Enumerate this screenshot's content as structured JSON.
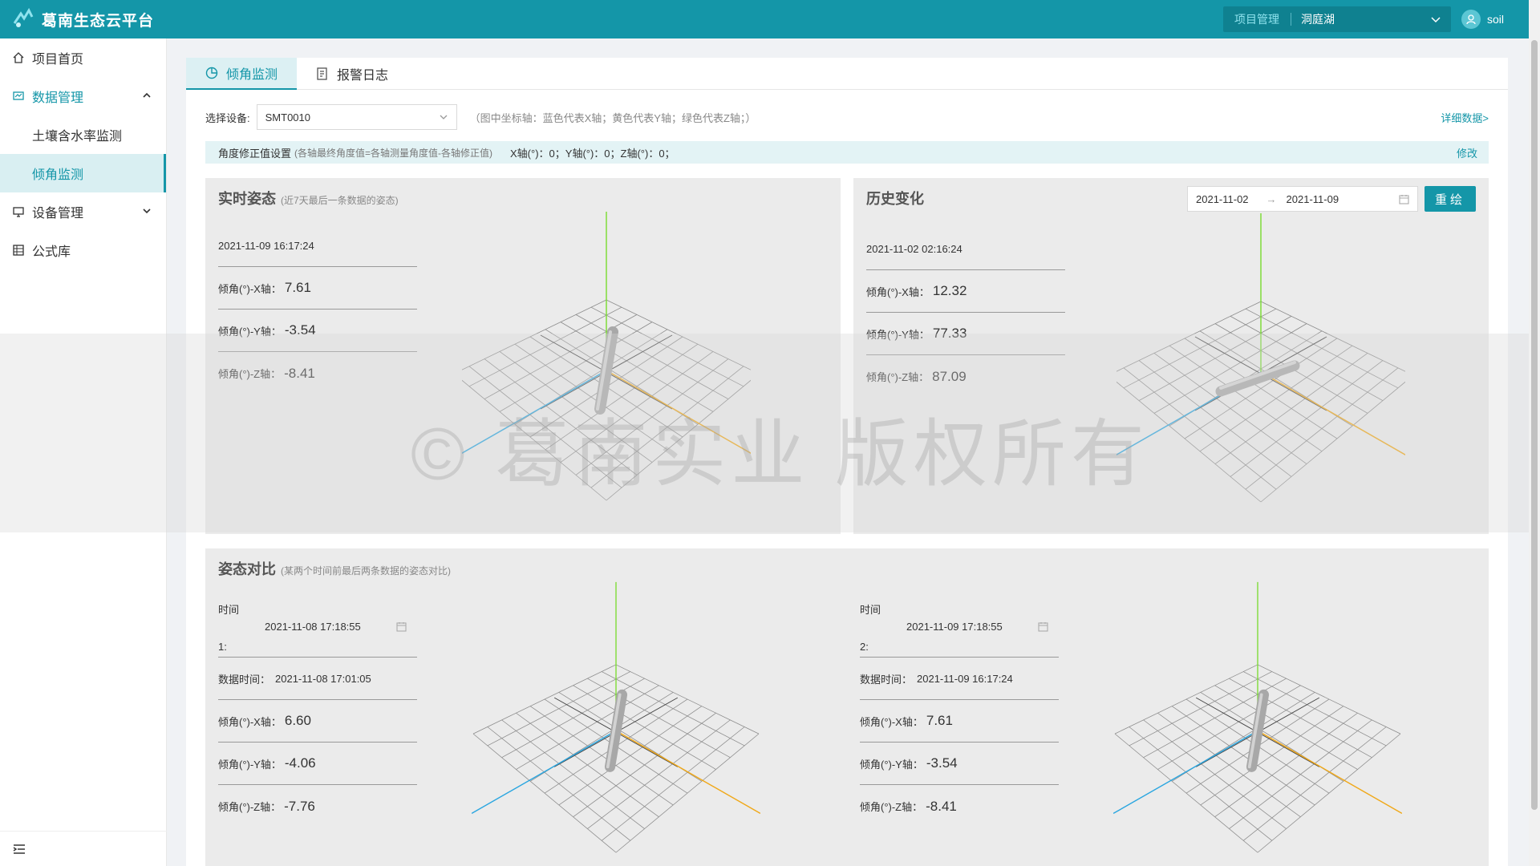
{
  "header": {
    "app_title": "葛南生态云平台",
    "project_label": "项目管理",
    "project_value": "洞庭湖",
    "user_name": "soil"
  },
  "sidebar": {
    "items": [
      {
        "label": "项目首页",
        "icon": "home-icon"
      },
      {
        "label": "数据管理",
        "icon": "chart-icon",
        "expanded": true
      },
      {
        "label": "土壤含水率监测",
        "sub": true
      },
      {
        "label": "倾角监测",
        "sub": true,
        "active": true
      },
      {
        "label": "设备管理",
        "icon": "monitor-icon"
      },
      {
        "label": "公式库",
        "icon": "table-icon"
      }
    ]
  },
  "tabs": [
    {
      "label": "倾角监测",
      "icon": "pie-icon",
      "active": true
    },
    {
      "label": "报警日志",
      "icon": "log-icon"
    }
  ],
  "device": {
    "label": "选择设备:",
    "value": "SMT0010",
    "hint": "（图中坐标轴：蓝色代表X轴；黄色代表Y轴；绿色代表Z轴；）",
    "detail_link": "详细数据>"
  },
  "correction": {
    "label": "角度修正值设置",
    "sub": "(各轴最终角度值=各轴测量角度值-各轴修正值)",
    "values": "X轴(°)：0；Y轴(°)：0；Z轴(°)：0；",
    "edit": "修改"
  },
  "realtime": {
    "title": "实时姿态",
    "subtitle": "(近7天最后一条数据的姿态)",
    "time": "2021-11-09 16:17:24",
    "x_label": "倾角(°)-X轴：",
    "x": "7.61",
    "y_label": "倾角(°)-Y轴：",
    "y": "-3.54",
    "z_label": "倾角(°)-Z轴：",
    "z": "-8.41"
  },
  "history": {
    "title": "历史变化",
    "start_date": "2021-11-02",
    "end_date": "2021-11-09",
    "redraw": "重绘",
    "time": "2021-11-02 02:16:24",
    "x_label": "倾角(°)-X轴：",
    "x": "12.32",
    "y_label": "倾角(°)-Y轴：",
    "y": "77.33",
    "z_label": "倾角(°)-Z轴：",
    "z": "87.09"
  },
  "compare": {
    "title": "姿态对比",
    "subtitle": "(某两个时间前最后两条数据的姿态对比)",
    "left": {
      "time_label": "时间",
      "index": "1:",
      "picker": "2021-11-08 17:18:55",
      "data_time_label": "数据时间：",
      "data_time": "2021-11-08 17:01:05",
      "x_label": "倾角(°)-X轴：",
      "x": "6.60",
      "y_label": "倾角(°)-Y轴：",
      "y": "-4.06",
      "z_label": "倾角(°)-Z轴：",
      "z": "-7.76"
    },
    "right": {
      "time_label": "时间",
      "index": "2:",
      "picker": "2021-11-09 17:18:55",
      "data_time_label": "数据时间：",
      "data_time": "2021-11-09 16:17:24",
      "x_label": "倾角(°)-X轴：",
      "x": "7.61",
      "y_label": "倾角(°)-Y轴：",
      "y": "-3.54",
      "z_label": "倾角(°)-Z轴：",
      "z": "-8.41"
    }
  },
  "watermark": "© 葛南实业 版权所有",
  "colors": {
    "primary": "#1496a8",
    "x_axis": "#2aa6e0",
    "y_axis": "#f0a818",
    "z_axis": "#7fdc3a"
  }
}
